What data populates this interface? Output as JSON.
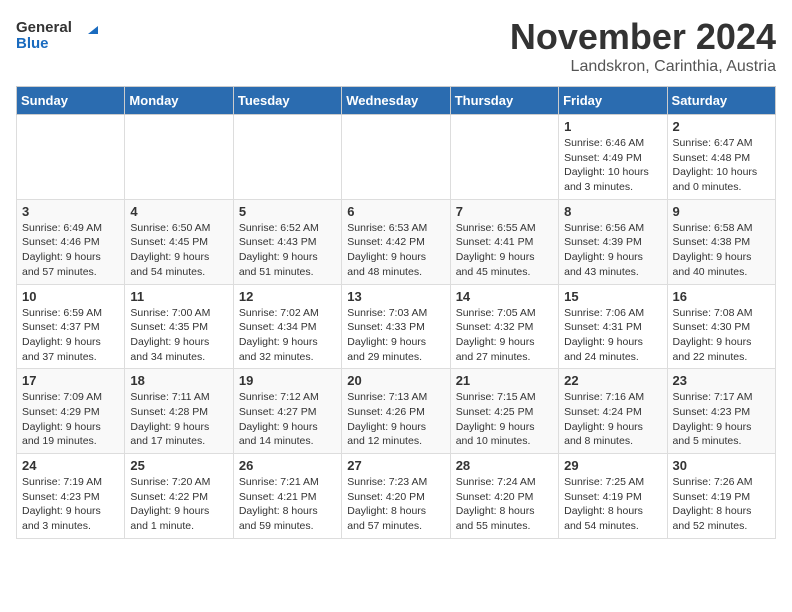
{
  "logo": {
    "text_general": "General",
    "text_blue": "Blue"
  },
  "title": "November 2024",
  "location": "Landskron, Carinthia, Austria",
  "days_of_week": [
    "Sunday",
    "Monday",
    "Tuesday",
    "Wednesday",
    "Thursday",
    "Friday",
    "Saturday"
  ],
  "weeks": [
    [
      {
        "day": "",
        "info": ""
      },
      {
        "day": "",
        "info": ""
      },
      {
        "day": "",
        "info": ""
      },
      {
        "day": "",
        "info": ""
      },
      {
        "day": "",
        "info": ""
      },
      {
        "day": "1",
        "info": "Sunrise: 6:46 AM\nSunset: 4:49 PM\nDaylight: 10 hours and 3 minutes."
      },
      {
        "day": "2",
        "info": "Sunrise: 6:47 AM\nSunset: 4:48 PM\nDaylight: 10 hours and 0 minutes."
      }
    ],
    [
      {
        "day": "3",
        "info": "Sunrise: 6:49 AM\nSunset: 4:46 PM\nDaylight: 9 hours and 57 minutes."
      },
      {
        "day": "4",
        "info": "Sunrise: 6:50 AM\nSunset: 4:45 PM\nDaylight: 9 hours and 54 minutes."
      },
      {
        "day": "5",
        "info": "Sunrise: 6:52 AM\nSunset: 4:43 PM\nDaylight: 9 hours and 51 minutes."
      },
      {
        "day": "6",
        "info": "Sunrise: 6:53 AM\nSunset: 4:42 PM\nDaylight: 9 hours and 48 minutes."
      },
      {
        "day": "7",
        "info": "Sunrise: 6:55 AM\nSunset: 4:41 PM\nDaylight: 9 hours and 45 minutes."
      },
      {
        "day": "8",
        "info": "Sunrise: 6:56 AM\nSunset: 4:39 PM\nDaylight: 9 hours and 43 minutes."
      },
      {
        "day": "9",
        "info": "Sunrise: 6:58 AM\nSunset: 4:38 PM\nDaylight: 9 hours and 40 minutes."
      }
    ],
    [
      {
        "day": "10",
        "info": "Sunrise: 6:59 AM\nSunset: 4:37 PM\nDaylight: 9 hours and 37 minutes."
      },
      {
        "day": "11",
        "info": "Sunrise: 7:00 AM\nSunset: 4:35 PM\nDaylight: 9 hours and 34 minutes."
      },
      {
        "day": "12",
        "info": "Sunrise: 7:02 AM\nSunset: 4:34 PM\nDaylight: 9 hours and 32 minutes."
      },
      {
        "day": "13",
        "info": "Sunrise: 7:03 AM\nSunset: 4:33 PM\nDaylight: 9 hours and 29 minutes."
      },
      {
        "day": "14",
        "info": "Sunrise: 7:05 AM\nSunset: 4:32 PM\nDaylight: 9 hours and 27 minutes."
      },
      {
        "day": "15",
        "info": "Sunrise: 7:06 AM\nSunset: 4:31 PM\nDaylight: 9 hours and 24 minutes."
      },
      {
        "day": "16",
        "info": "Sunrise: 7:08 AM\nSunset: 4:30 PM\nDaylight: 9 hours and 22 minutes."
      }
    ],
    [
      {
        "day": "17",
        "info": "Sunrise: 7:09 AM\nSunset: 4:29 PM\nDaylight: 9 hours and 19 minutes."
      },
      {
        "day": "18",
        "info": "Sunrise: 7:11 AM\nSunset: 4:28 PM\nDaylight: 9 hours and 17 minutes."
      },
      {
        "day": "19",
        "info": "Sunrise: 7:12 AM\nSunset: 4:27 PM\nDaylight: 9 hours and 14 minutes."
      },
      {
        "day": "20",
        "info": "Sunrise: 7:13 AM\nSunset: 4:26 PM\nDaylight: 9 hours and 12 minutes."
      },
      {
        "day": "21",
        "info": "Sunrise: 7:15 AM\nSunset: 4:25 PM\nDaylight: 9 hours and 10 minutes."
      },
      {
        "day": "22",
        "info": "Sunrise: 7:16 AM\nSunset: 4:24 PM\nDaylight: 9 hours and 8 minutes."
      },
      {
        "day": "23",
        "info": "Sunrise: 7:17 AM\nSunset: 4:23 PM\nDaylight: 9 hours and 5 minutes."
      }
    ],
    [
      {
        "day": "24",
        "info": "Sunrise: 7:19 AM\nSunset: 4:23 PM\nDaylight: 9 hours and 3 minutes."
      },
      {
        "day": "25",
        "info": "Sunrise: 7:20 AM\nSunset: 4:22 PM\nDaylight: 9 hours and 1 minute."
      },
      {
        "day": "26",
        "info": "Sunrise: 7:21 AM\nSunset: 4:21 PM\nDaylight: 8 hours and 59 minutes."
      },
      {
        "day": "27",
        "info": "Sunrise: 7:23 AM\nSunset: 4:20 PM\nDaylight: 8 hours and 57 minutes."
      },
      {
        "day": "28",
        "info": "Sunrise: 7:24 AM\nSunset: 4:20 PM\nDaylight: 8 hours and 55 minutes."
      },
      {
        "day": "29",
        "info": "Sunrise: 7:25 AM\nSunset: 4:19 PM\nDaylight: 8 hours and 54 minutes."
      },
      {
        "day": "30",
        "info": "Sunrise: 7:26 AM\nSunset: 4:19 PM\nDaylight: 8 hours and 52 minutes."
      }
    ]
  ]
}
